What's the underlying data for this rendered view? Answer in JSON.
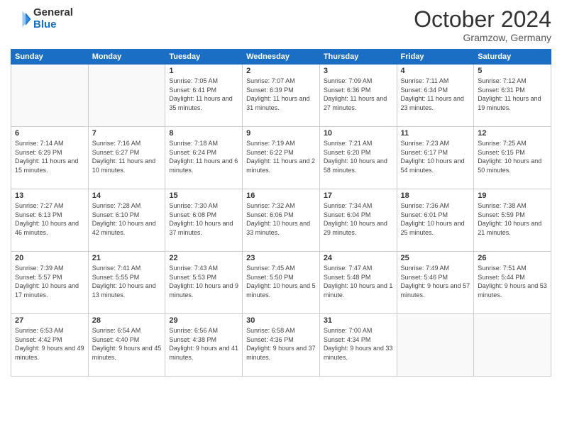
{
  "header": {
    "logo_general": "General",
    "logo_blue": "Blue",
    "month_title": "October 2024",
    "location": "Gramzow, Germany"
  },
  "days_of_week": [
    "Sunday",
    "Monday",
    "Tuesday",
    "Wednesday",
    "Thursday",
    "Friday",
    "Saturday"
  ],
  "weeks": [
    [
      {
        "day": "",
        "info": ""
      },
      {
        "day": "",
        "info": ""
      },
      {
        "day": "1",
        "info": "Sunrise: 7:05 AM\nSunset: 6:41 PM\nDaylight: 11 hours and 35 minutes."
      },
      {
        "day": "2",
        "info": "Sunrise: 7:07 AM\nSunset: 6:39 PM\nDaylight: 11 hours and 31 minutes."
      },
      {
        "day": "3",
        "info": "Sunrise: 7:09 AM\nSunset: 6:36 PM\nDaylight: 11 hours and 27 minutes."
      },
      {
        "day": "4",
        "info": "Sunrise: 7:11 AM\nSunset: 6:34 PM\nDaylight: 11 hours and 23 minutes."
      },
      {
        "day": "5",
        "info": "Sunrise: 7:12 AM\nSunset: 6:31 PM\nDaylight: 11 hours and 19 minutes."
      }
    ],
    [
      {
        "day": "6",
        "info": "Sunrise: 7:14 AM\nSunset: 6:29 PM\nDaylight: 11 hours and 15 minutes."
      },
      {
        "day": "7",
        "info": "Sunrise: 7:16 AM\nSunset: 6:27 PM\nDaylight: 11 hours and 10 minutes."
      },
      {
        "day": "8",
        "info": "Sunrise: 7:18 AM\nSunset: 6:24 PM\nDaylight: 11 hours and 6 minutes."
      },
      {
        "day": "9",
        "info": "Sunrise: 7:19 AM\nSunset: 6:22 PM\nDaylight: 11 hours and 2 minutes."
      },
      {
        "day": "10",
        "info": "Sunrise: 7:21 AM\nSunset: 6:20 PM\nDaylight: 10 hours and 58 minutes."
      },
      {
        "day": "11",
        "info": "Sunrise: 7:23 AM\nSunset: 6:17 PM\nDaylight: 10 hours and 54 minutes."
      },
      {
        "day": "12",
        "info": "Sunrise: 7:25 AM\nSunset: 6:15 PM\nDaylight: 10 hours and 50 minutes."
      }
    ],
    [
      {
        "day": "13",
        "info": "Sunrise: 7:27 AM\nSunset: 6:13 PM\nDaylight: 10 hours and 46 minutes."
      },
      {
        "day": "14",
        "info": "Sunrise: 7:28 AM\nSunset: 6:10 PM\nDaylight: 10 hours and 42 minutes."
      },
      {
        "day": "15",
        "info": "Sunrise: 7:30 AM\nSunset: 6:08 PM\nDaylight: 10 hours and 37 minutes."
      },
      {
        "day": "16",
        "info": "Sunrise: 7:32 AM\nSunset: 6:06 PM\nDaylight: 10 hours and 33 minutes."
      },
      {
        "day": "17",
        "info": "Sunrise: 7:34 AM\nSunset: 6:04 PM\nDaylight: 10 hours and 29 minutes."
      },
      {
        "day": "18",
        "info": "Sunrise: 7:36 AM\nSunset: 6:01 PM\nDaylight: 10 hours and 25 minutes."
      },
      {
        "day": "19",
        "info": "Sunrise: 7:38 AM\nSunset: 5:59 PM\nDaylight: 10 hours and 21 minutes."
      }
    ],
    [
      {
        "day": "20",
        "info": "Sunrise: 7:39 AM\nSunset: 5:57 PM\nDaylight: 10 hours and 17 minutes."
      },
      {
        "day": "21",
        "info": "Sunrise: 7:41 AM\nSunset: 5:55 PM\nDaylight: 10 hours and 13 minutes."
      },
      {
        "day": "22",
        "info": "Sunrise: 7:43 AM\nSunset: 5:53 PM\nDaylight: 10 hours and 9 minutes."
      },
      {
        "day": "23",
        "info": "Sunrise: 7:45 AM\nSunset: 5:50 PM\nDaylight: 10 hours and 5 minutes."
      },
      {
        "day": "24",
        "info": "Sunrise: 7:47 AM\nSunset: 5:48 PM\nDaylight: 10 hours and 1 minute."
      },
      {
        "day": "25",
        "info": "Sunrise: 7:49 AM\nSunset: 5:46 PM\nDaylight: 9 hours and 57 minutes."
      },
      {
        "day": "26",
        "info": "Sunrise: 7:51 AM\nSunset: 5:44 PM\nDaylight: 9 hours and 53 minutes."
      }
    ],
    [
      {
        "day": "27",
        "info": "Sunrise: 6:53 AM\nSunset: 4:42 PM\nDaylight: 9 hours and 49 minutes."
      },
      {
        "day": "28",
        "info": "Sunrise: 6:54 AM\nSunset: 4:40 PM\nDaylight: 9 hours and 45 minutes."
      },
      {
        "day": "29",
        "info": "Sunrise: 6:56 AM\nSunset: 4:38 PM\nDaylight: 9 hours and 41 minutes."
      },
      {
        "day": "30",
        "info": "Sunrise: 6:58 AM\nSunset: 4:36 PM\nDaylight: 9 hours and 37 minutes."
      },
      {
        "day": "31",
        "info": "Sunrise: 7:00 AM\nSunset: 4:34 PM\nDaylight: 9 hours and 33 minutes."
      },
      {
        "day": "",
        "info": ""
      },
      {
        "day": "",
        "info": ""
      }
    ]
  ]
}
